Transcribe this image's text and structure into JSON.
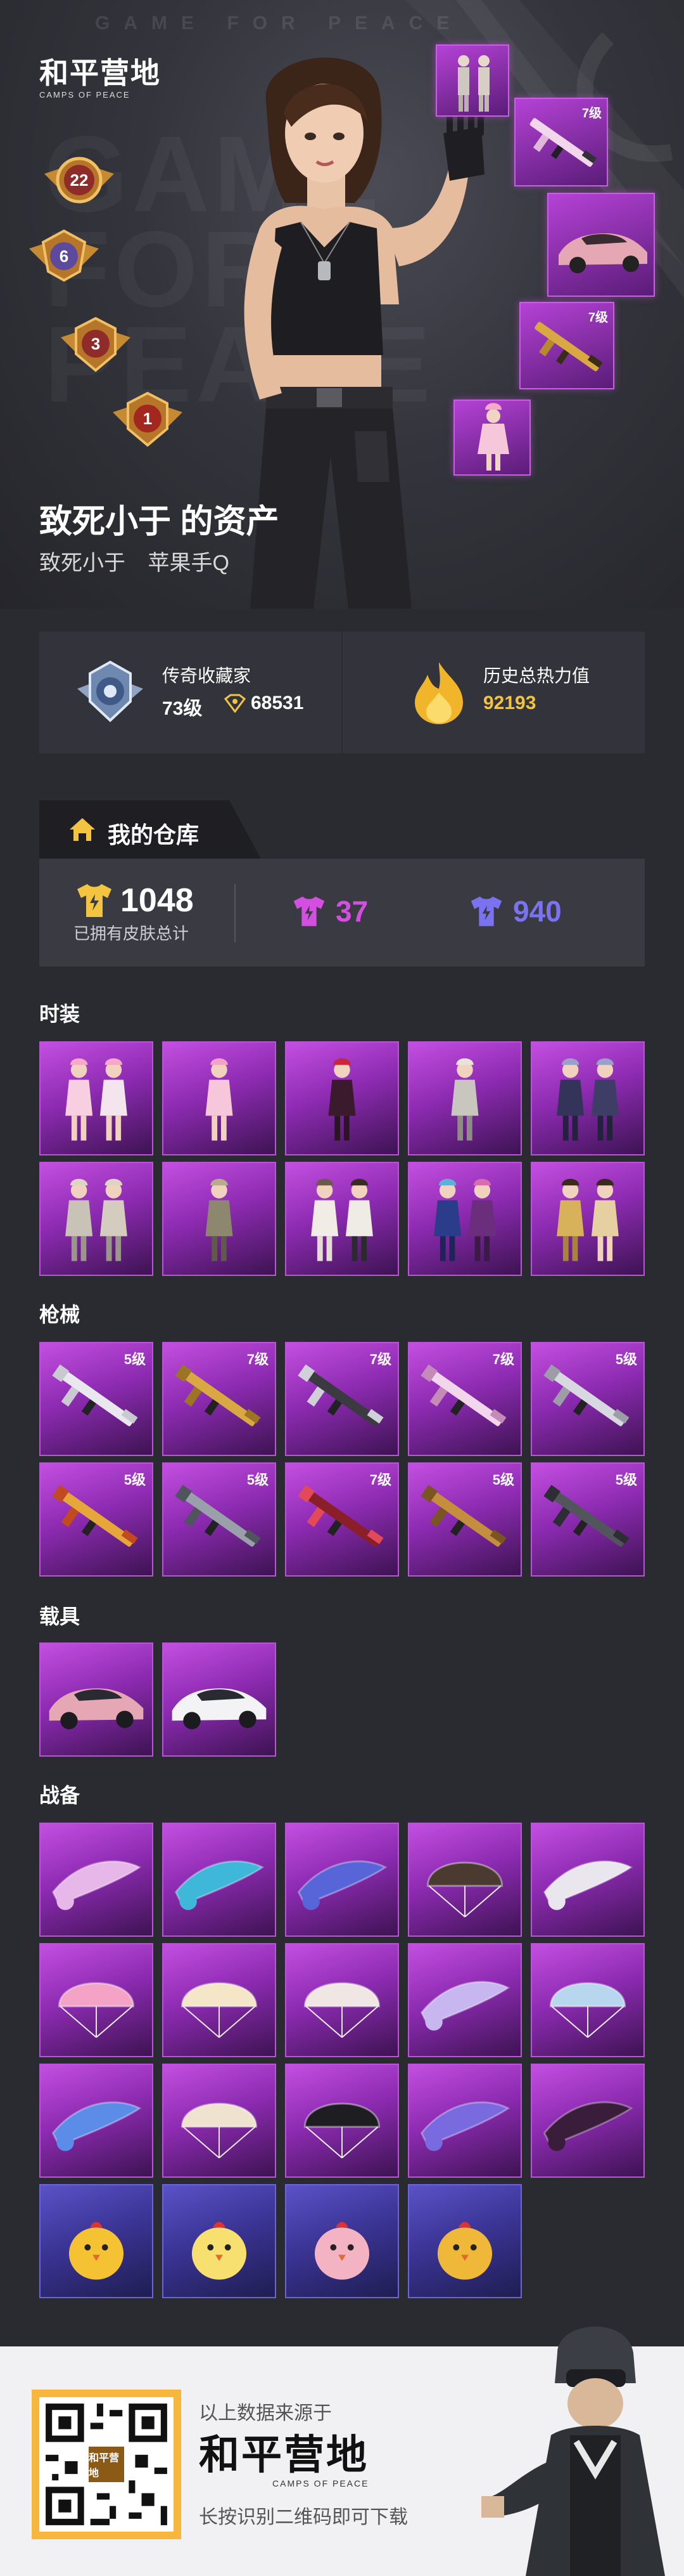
{
  "hero": {
    "watermark": "GAME FOR PEACE",
    "bg_text": "GAME\nFOR\nPEACE",
    "logo_main": "和平营地",
    "logo_sub": "CAMPS OF PEACE",
    "rank_badges": [
      "22",
      "6",
      "3",
      "1"
    ],
    "side_items": [
      {
        "icon": "outfit-pair",
        "level": ""
      },
      {
        "icon": "rifle-pink",
        "level": "7级"
      },
      {
        "icon": "car-pink",
        "level": ""
      },
      {
        "icon": "rifle-gold",
        "level": "7级"
      },
      {
        "icon": "outfit-pink",
        "level": ""
      }
    ],
    "owner_title": "致死小于 的资产",
    "owner_name": "致死小于",
    "owner_platform": "苹果手Q"
  },
  "stats": {
    "collector_label": "传奇收藏家",
    "collector_level": "73级",
    "collector_points": "68531",
    "heat_label": "历史总热力值",
    "heat_value": "92193"
  },
  "warehouse": {
    "tab_label": "我的仓库",
    "total": "1048",
    "total_caption": "已拥有皮肤总计",
    "purple_count": "37",
    "blue_count": "940",
    "colors": {
      "gold": "#f3c440",
      "purple": "#d24fe0",
      "blue": "#7a72ee"
    }
  },
  "sections": {
    "fashion": {
      "title": "时装",
      "items": [
        {
          "icon": "outfit-bunny-pair",
          "level": ""
        },
        {
          "icon": "outfit-pink-dress",
          "level": ""
        },
        {
          "icon": "outfit-red-hair",
          "level": ""
        },
        {
          "icon": "outfit-knight",
          "level": ""
        },
        {
          "icon": "outfit-dark-pair",
          "level": ""
        },
        {
          "icon": "outfit-silver-pair",
          "level": ""
        },
        {
          "icon": "outfit-armor",
          "level": ""
        },
        {
          "icon": "outfit-wedding",
          "level": ""
        },
        {
          "icon": "outfit-dance-pair",
          "level": ""
        },
        {
          "icon": "outfit-gold-pair",
          "level": ""
        }
      ]
    },
    "weapons": {
      "title": "枪械",
      "items": [
        {
          "icon": "rifle-white",
          "level": "5级"
        },
        {
          "icon": "rifle-gold",
          "level": "7级"
        },
        {
          "icon": "rifle-black",
          "level": "7级"
        },
        {
          "icon": "rifle-pink",
          "level": "7级"
        },
        {
          "icon": "shotgun-silver",
          "level": "5级"
        },
        {
          "icon": "rifle-flame",
          "level": "5级"
        },
        {
          "icon": "rifle-grey",
          "level": "5级"
        },
        {
          "icon": "rifle-red",
          "level": "7级"
        },
        {
          "icon": "rifle-bronze",
          "level": "5级"
        },
        {
          "icon": "sniper-dark",
          "level": "5级"
        }
      ]
    },
    "vehicles": {
      "title": "载具",
      "items": [
        {
          "icon": "car-pink",
          "level": ""
        },
        {
          "icon": "car-white",
          "level": ""
        }
      ]
    },
    "gear": {
      "title": "战备",
      "items": [
        {
          "icon": "glider-crystal",
          "level": ""
        },
        {
          "icon": "glider-butterfly",
          "level": ""
        },
        {
          "icon": "glider-wing",
          "level": ""
        },
        {
          "icon": "parachute-dark",
          "level": ""
        },
        {
          "icon": "glider-white",
          "level": ""
        },
        {
          "icon": "parachute-pink",
          "level": ""
        },
        {
          "icon": "parachute-sheep",
          "level": ""
        },
        {
          "icon": "parachute-cat",
          "level": ""
        },
        {
          "icon": "glider-lavender",
          "level": ""
        },
        {
          "icon": "parachute-sky",
          "level": ""
        },
        {
          "icon": "glider-blue",
          "level": ""
        },
        {
          "icon": "parachute-cream",
          "level": ""
        },
        {
          "icon": "parachute-black-cat",
          "level": ""
        },
        {
          "icon": "glider-galaxy",
          "level": ""
        },
        {
          "icon": "glider-dark-pink",
          "level": ""
        },
        {
          "icon": "chick-goggles",
          "level": ""
        },
        {
          "icon": "chick-cream",
          "level": ""
        },
        {
          "icon": "chick-pink",
          "level": ""
        },
        {
          "icon": "chick-black-helmet",
          "level": ""
        }
      ]
    }
  },
  "footer": {
    "source_text": "以上数据来源于",
    "logo_main": "和平营地",
    "logo_sub": "CAMPS OF PEACE",
    "hint": "长按识别二维码即可下载",
    "qr_label": "和平营地"
  }
}
